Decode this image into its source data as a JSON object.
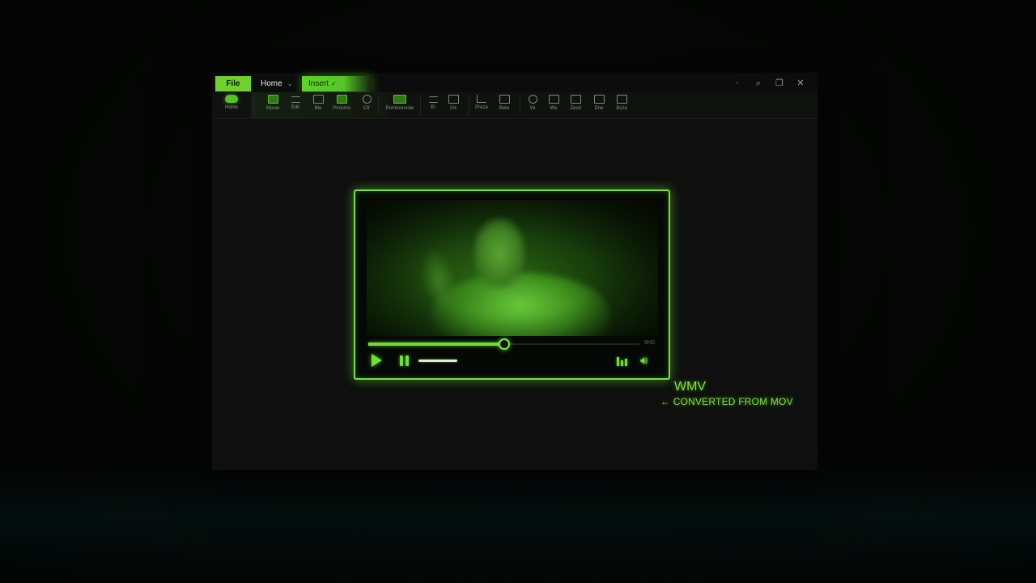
{
  "tabs": {
    "file": "File",
    "home": "Home",
    "insert": "Insert"
  },
  "window_controls": [
    "minimize-icon",
    "search-icon",
    "restore-icon",
    "close-icon"
  ],
  "ribbon": {
    "items": [
      {
        "label": "Home",
        "icon": "home-blob-icon"
      },
      {
        "label": "Movie",
        "icon": "movie-icon"
      },
      {
        "label": "Edit",
        "icon": "list-icon"
      },
      {
        "label": "Bte",
        "icon": "clip-icon"
      },
      {
        "label": "Pnncms",
        "icon": "frame-icon"
      },
      {
        "label": "Ctr",
        "icon": "circle-icon"
      },
      {
        "label": "Pomtosnvoie",
        "icon": "screen-icon"
      },
      {
        "label": "El",
        "icon": "lines-icon"
      },
      {
        "label": "1%",
        "icon": "stack-icon"
      },
      {
        "label": "Preza",
        "icon": "chart-icon"
      },
      {
        "label": "Beta",
        "icon": "doc-icon"
      },
      {
        "label": "Ve",
        "icon": "shape-icon"
      },
      {
        "label": "We",
        "icon": "box-icon"
      },
      {
        "label": "Zesd",
        "icon": "grid-icon"
      },
      {
        "label": "Dne",
        "icon": "rotate-icon"
      },
      {
        "label": "Bsza",
        "icon": "panel-icon"
      }
    ]
  },
  "player": {
    "progress": 0.5,
    "time_label": "8H0"
  },
  "annotation": {
    "format": "WMV",
    "converted": "← CONVERTED FROM MOV"
  },
  "colors": {
    "accent": "#6fdc33",
    "background": "#050605",
    "window": "#0e0f0e"
  }
}
